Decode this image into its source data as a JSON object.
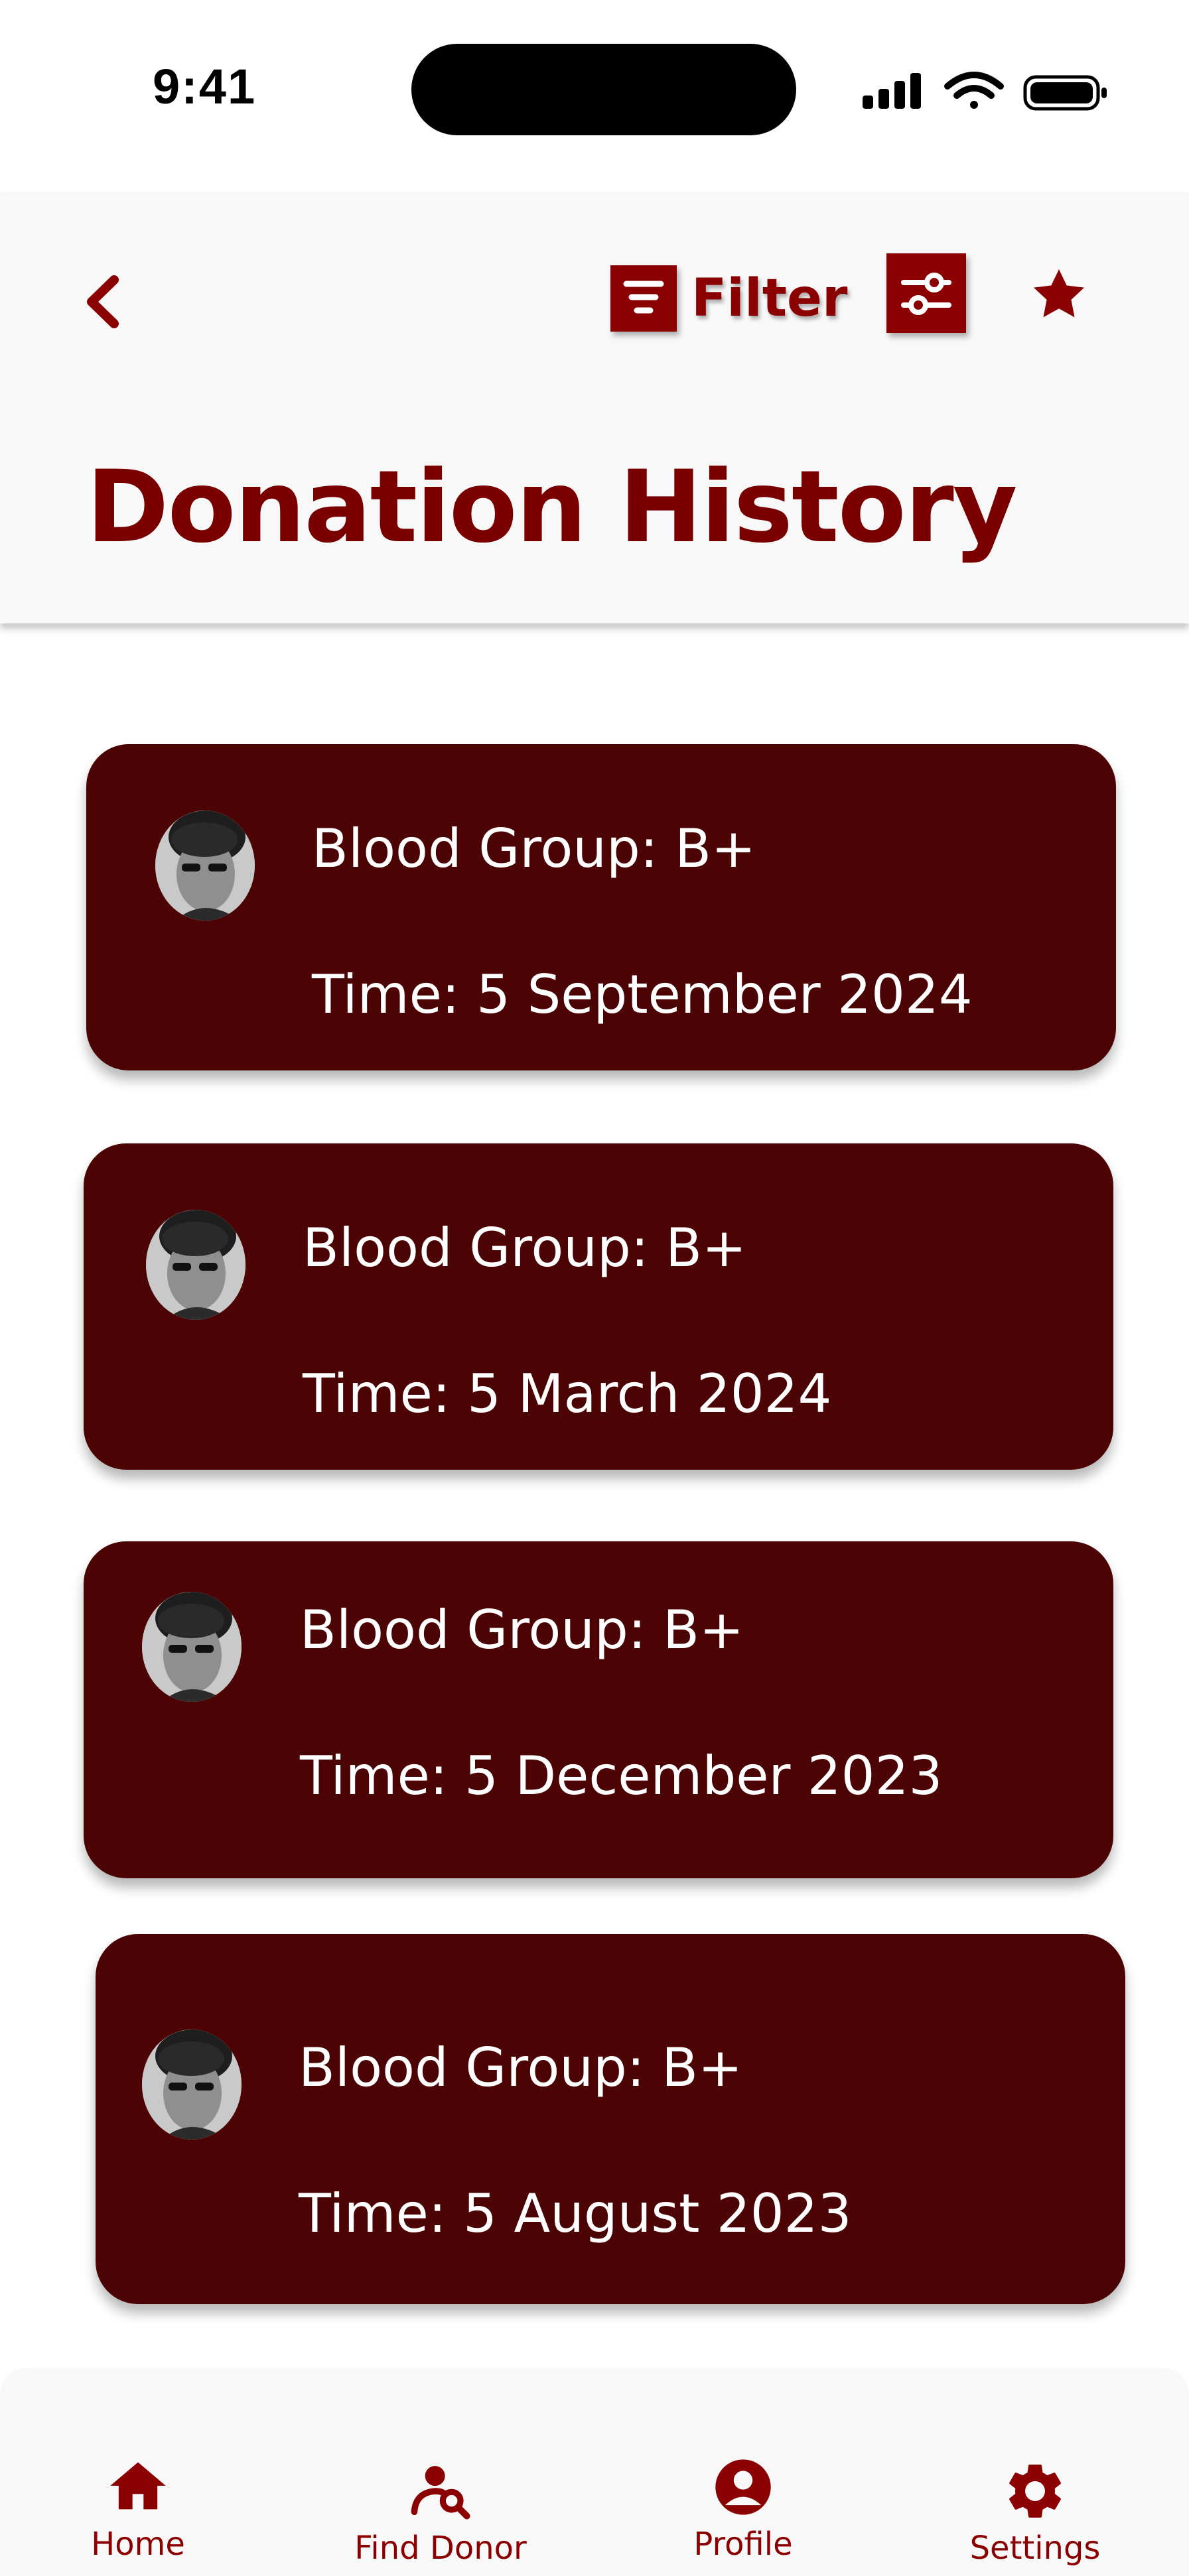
{
  "status_bar": {
    "time": "9:41"
  },
  "header": {
    "back_icon": "chevron-left-icon",
    "filter_label": "Filter",
    "filter_icon": "filter-icon",
    "settings_icon": "sliders-icon",
    "favorite_icon": "star-icon",
    "title": "Donation History"
  },
  "donations": [
    {
      "blood_group": "Blood Group: B+",
      "time": "Time: 5 September 2024"
    },
    {
      "blood_group": "Blood Group: B+",
      "time": "Time: 5 March 2024"
    },
    {
      "blood_group": "Blood Group: B+",
      "time": "Time: 5 December 2023"
    },
    {
      "blood_group": "Blood Group: B+",
      "time": "Time: 5 August 2023"
    }
  ],
  "nav": [
    {
      "label": "Home",
      "icon": "home-icon"
    },
    {
      "label": "Find Donor",
      "icon": "find-donor-icon"
    },
    {
      "label": "Profile",
      "icon": "profile-icon"
    },
    {
      "label": "Settings",
      "icon": "gear-icon"
    }
  ],
  "colors": {
    "accent": "#8b0000",
    "card": "#4b0303",
    "header_bg": "#f8f8f8"
  }
}
